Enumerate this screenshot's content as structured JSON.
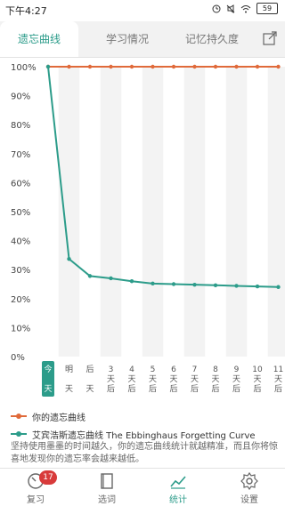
{
  "status_bar": {
    "time": "下午4:27",
    "battery": "59",
    "icons": [
      "alarm-icon",
      "mute-icon",
      "wifi-icon",
      "battery-icon"
    ]
  },
  "tabs": [
    {
      "label": "遗忘曲线",
      "active": true
    },
    {
      "label": "学习情况",
      "active": false
    },
    {
      "label": "记忆持久度",
      "active": false
    }
  ],
  "share_icon": "share-icon",
  "chart_data": {
    "type": "line",
    "x_labels": [
      {
        "top": "今",
        "bottom": "天",
        "highlight": true
      },
      {
        "top": "明",
        "bottom": "天"
      },
      {
        "top": "后",
        "bottom": "天"
      },
      {
        "top": "3",
        "mid": "天",
        "bottom": "后"
      },
      {
        "top": "4",
        "mid": "天",
        "bottom": "后"
      },
      {
        "top": "5",
        "mid": "天",
        "bottom": "后"
      },
      {
        "top": "6",
        "mid": "天",
        "bottom": "后"
      },
      {
        "top": "7",
        "mid": "天",
        "bottom": "后"
      },
      {
        "top": "8",
        "mid": "天",
        "bottom": "后"
      },
      {
        "top": "9",
        "mid": "天",
        "bottom": "后"
      },
      {
        "top": "10",
        "mid": "天",
        "bottom": "后"
      },
      {
        "top": "11",
        "mid": "天",
        "bottom": "后"
      }
    ],
    "y_ticks": [
      "0%",
      "10%",
      "20%",
      "30%",
      "40%",
      "50%",
      "60%",
      "70%",
      "80%",
      "90%",
      "100%"
    ],
    "ylim": [
      0,
      100
    ],
    "series": [
      {
        "name": "你的遗忘曲线",
        "color": "#e06a3a",
        "values": [
          100,
          100,
          100,
          100,
          100,
          100,
          100,
          100,
          100,
          100,
          100,
          100
        ]
      },
      {
        "name": "艾宾浩斯遗忘曲线 The Ebbinghaus Forgetting Curve",
        "color": "#2c9c8a",
        "values": [
          100,
          33.7,
          27.8,
          27.0,
          26.0,
          25.2,
          25.0,
          24.8,
          24.6,
          24.4,
          24.2,
          24.0
        ]
      }
    ],
    "grid": "alternating vertical bands"
  },
  "legend": [
    {
      "label": "你的遗忘曲线",
      "color": "#e06a3a"
    },
    {
      "label": "艾宾浩斯遗忘曲线 The Ebbinghaus Forgetting Curve",
      "color": "#2c9c8a"
    }
  ],
  "note": "坚持使用墨墨的时间越久，你的遗忘曲线统计就越精准，而且你将惊喜地发现你的遗忘率会越来越低。",
  "bottom_nav": [
    {
      "label": "复习",
      "icon": "review-icon",
      "badge": "17",
      "active": false
    },
    {
      "label": "选词",
      "icon": "book-icon",
      "active": false
    },
    {
      "label": "统计",
      "icon": "stats-icon",
      "active": true
    },
    {
      "label": "设置",
      "icon": "gear-icon",
      "active": false
    }
  ]
}
